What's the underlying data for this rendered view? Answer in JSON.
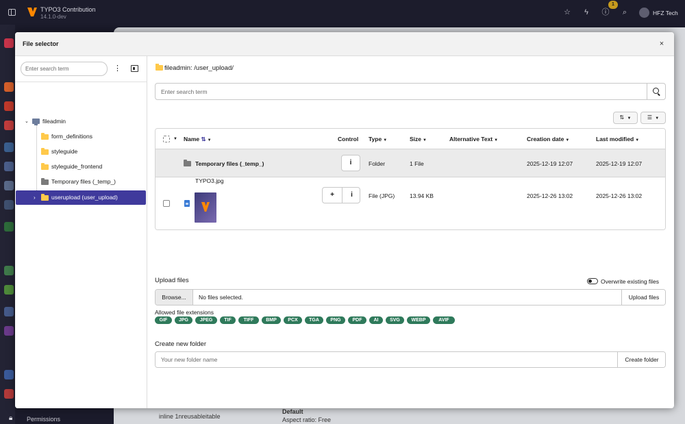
{
  "app": {
    "title": "TYPO3 Contribution",
    "version": "14.1.0-dev",
    "notification_count": "1",
    "user_name": "HFZ Tech",
    "bg_permissions": "Permissions",
    "bg_item": "inline 1nreusableitable",
    "bg_default": "Default",
    "bg_aspect": "Aspect ratio: Free"
  },
  "modal": {
    "title": "File selector",
    "close": "×"
  },
  "tree": {
    "search_placeholder": "Enter search term",
    "nodes": [
      {
        "label": "fileadmin"
      },
      {
        "label": "form_definitions"
      },
      {
        "label": "styleguide"
      },
      {
        "label": "styleguide_frontend"
      },
      {
        "label": "Temporary files (_temp_)"
      },
      {
        "label": "userupload (user_upload)"
      }
    ]
  },
  "main": {
    "path": "fileadmin: /user_upload/",
    "search_placeholder": "Enter search term",
    "columns": {
      "name": "Name",
      "control": "Control",
      "type": "Type",
      "size": "Size",
      "alt": "Alternative Text",
      "created": "Creation date",
      "modified": "Last modified"
    },
    "rows": [
      {
        "name": "Temporary files (_temp_)",
        "type": "Folder",
        "size": "1 File",
        "created": "2025-12-19 12:07",
        "modified": "2025-12-19 12:07"
      },
      {
        "name": "TYPO3.jpg",
        "type": "File (JPG)",
        "size": "13.94 KB",
        "created": "2025-12-26 13:02",
        "modified": "2025-12-26 13:02"
      }
    ]
  },
  "upload": {
    "title": "Upload files",
    "overwrite_label": "Overwrite existing files",
    "browse_label": "Browse...",
    "no_file": "No files selected.",
    "upload_button": "Upload files",
    "allowed_label": "Allowed file extensions",
    "extensions": [
      "GIF",
      "JPG",
      "JPEG",
      "TIF",
      "TIFF",
      "BMP",
      "PCX",
      "TGA",
      "PNG",
      "PDF",
      "AI",
      "SVG",
      "WEBP",
      "AVIF"
    ]
  },
  "folder": {
    "title": "Create new folder",
    "placeholder": "Your new folder name",
    "button": "Create folder"
  },
  "colors": {
    "accent": "#3f3a9c",
    "badge": "#2f7a5b",
    "folder": "#ffc94a"
  }
}
